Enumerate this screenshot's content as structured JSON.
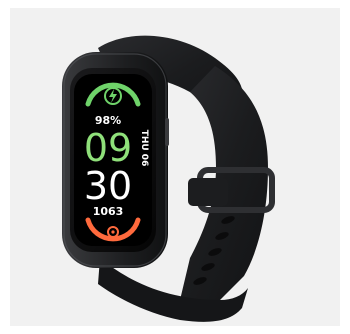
{
  "watch": {
    "battery_percent": "98%",
    "hour": "09",
    "minute": "30",
    "date": "THU 06",
    "steps": "1063"
  },
  "colors": {
    "background": "#f1f1f1",
    "band": "#1b1c1e",
    "screen": "#000000",
    "hour_green": "#8fe07a",
    "minute_white": "#ffffff",
    "battery_arc": "#6fd36a",
    "steps_arc": "#ff6a3d",
    "bezel": "#2a2b2e"
  },
  "icons": {
    "battery": "lightning-bolt-icon",
    "steps": "activity-ring-icon"
  }
}
